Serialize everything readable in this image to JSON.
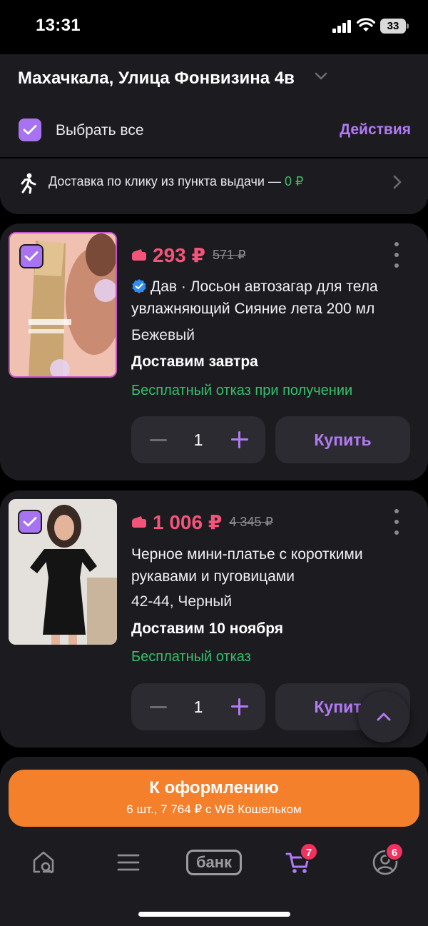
{
  "status": {
    "time": "13:31",
    "battery": "33"
  },
  "header": {
    "address": "Махачкала, Улица Фонвизина 4в",
    "select_all": "Выбрать все",
    "actions": "Действия"
  },
  "delivery_banner": {
    "text": "Доставка по клику из пункта выдачи — ",
    "price": "0 ₽"
  },
  "items": [
    {
      "price": "293 ₽",
      "old_price": "571 ₽",
      "verified": true,
      "title": "Дав · Лосьон автозагар для тела увлажняющий Сияние лета 200 мл",
      "variant": "Бежевый",
      "delivery": "Доставим завтра",
      "refund": "Бесплатный отказ при получении",
      "quantity": "1",
      "buy": "Купить",
      "selected": true
    },
    {
      "price": "1 006 ₽",
      "old_price": "4 345 ₽",
      "verified": false,
      "title": "Черное мини-платье с короткими рукавами и пуговицами",
      "variant": "42-44, Черный",
      "delivery": "Доставим 10 ноября",
      "refund": "Бесплатный отказ",
      "quantity": "1",
      "buy": "Купить",
      "selected": true
    }
  ],
  "checkout": {
    "title": "К оформлению",
    "subtitle": "6 шт., 7 764 ₽ с WB Кошельком"
  },
  "tab_bar": {
    "bank_label": "банк",
    "cart_count": "7",
    "profile_count": "6"
  },
  "colors": {
    "accent": "#b27bf6",
    "price": "#f5547a",
    "success": "#35c06b",
    "checkout": "#f4802c",
    "badge": "#f0325f"
  }
}
